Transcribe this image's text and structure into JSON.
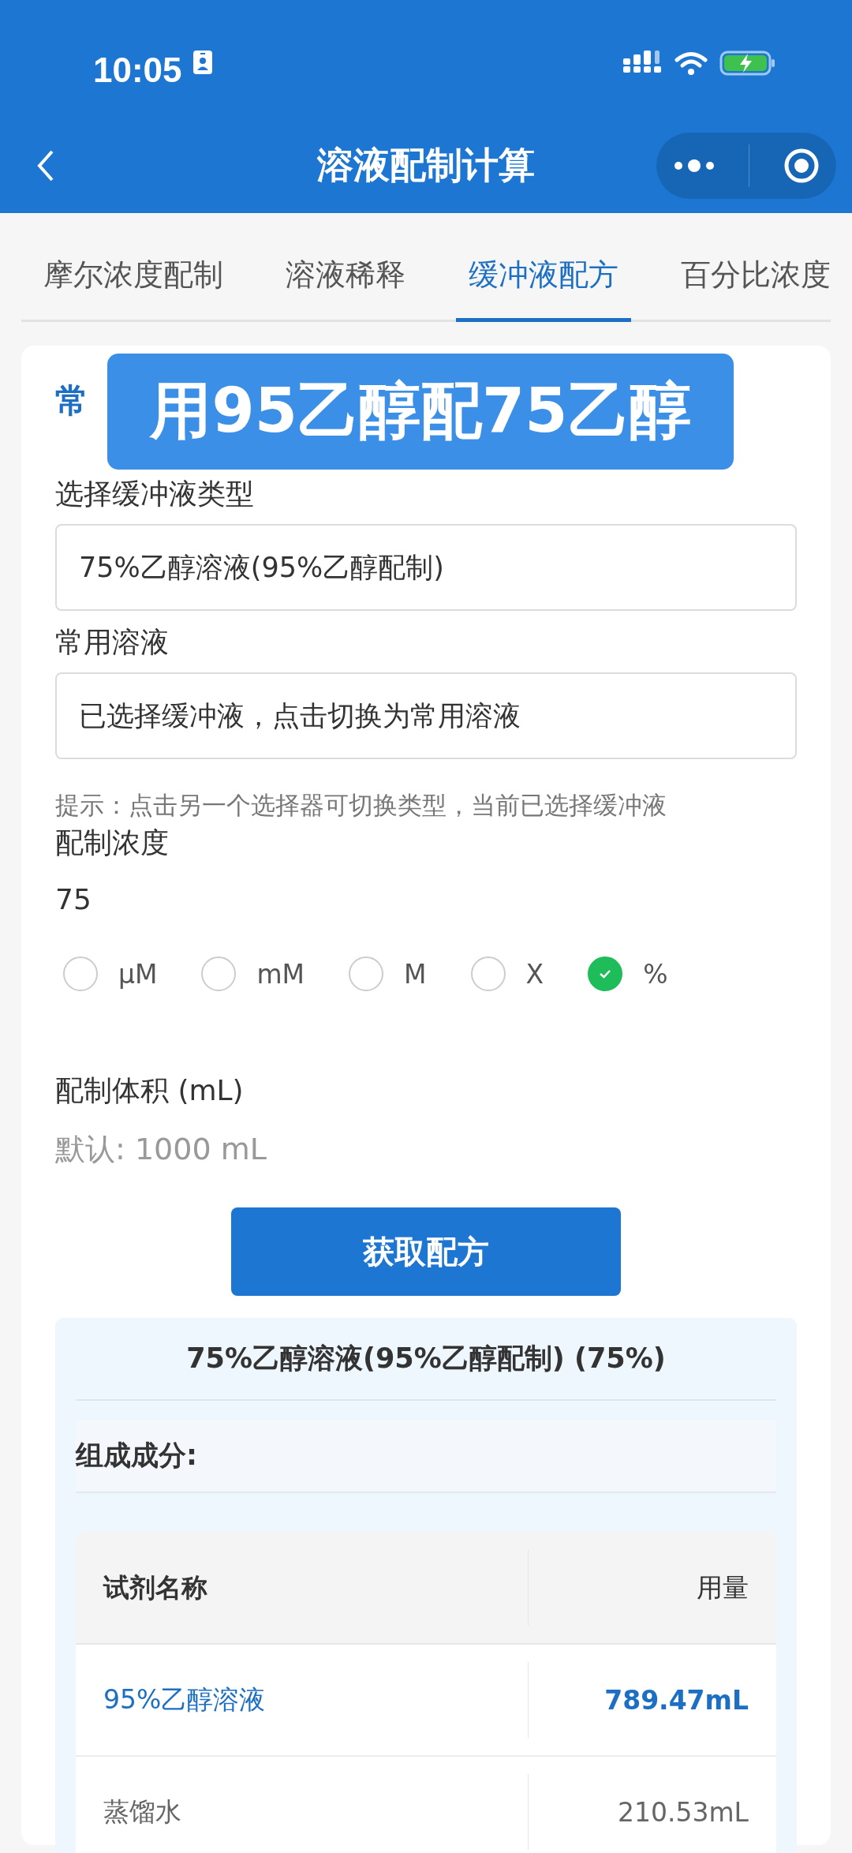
{
  "status_bar": {
    "time": "10:05"
  },
  "nav": {
    "title": "溶液配制计算"
  },
  "tabs": [
    {
      "label": "摩尔浓度配制",
      "selected": false
    },
    {
      "label": "溶液稀释",
      "selected": false
    },
    {
      "label": "缓冲液配方",
      "selected": true
    },
    {
      "label": "百分比浓度",
      "selected": false
    }
  ],
  "section_heading": "常",
  "caption_overlay": "用95乙醇配75乙醇",
  "buffer_type": {
    "label": "选择缓冲液类型",
    "value": "75%乙醇溶液(95%乙醇配制)"
  },
  "common_solution": {
    "label": "常用溶液",
    "value": "已选择缓冲液，点击切换为常用溶液"
  },
  "hint": "提示：点击另一个选择器可切换类型，当前已选择缓冲液",
  "concentration": {
    "label": "配制浓度",
    "value": "75"
  },
  "units": [
    {
      "label": "μM",
      "selected": false
    },
    {
      "label": "mM",
      "selected": false
    },
    {
      "label": "M",
      "selected": false
    },
    {
      "label": "X",
      "selected": false
    },
    {
      "label": "%",
      "selected": true
    }
  ],
  "volume": {
    "label": "配制体积 (mL)",
    "placeholder": "默认: 1000 mL"
  },
  "submit_button": "获取配方",
  "result": {
    "title": "75%乙醇溶液(95%乙醇配制) (75%)",
    "components_heading": "组成成分:",
    "columns": [
      "试剂名称",
      "用量"
    ],
    "rows": [
      {
        "kind": "highlight",
        "cells": [
          "95%乙醇溶液",
          "789.47mL"
        ]
      },
      {
        "kind": "plain",
        "cells": [
          "蒸馏水",
          "210.53mL"
        ]
      }
    ]
  }
}
